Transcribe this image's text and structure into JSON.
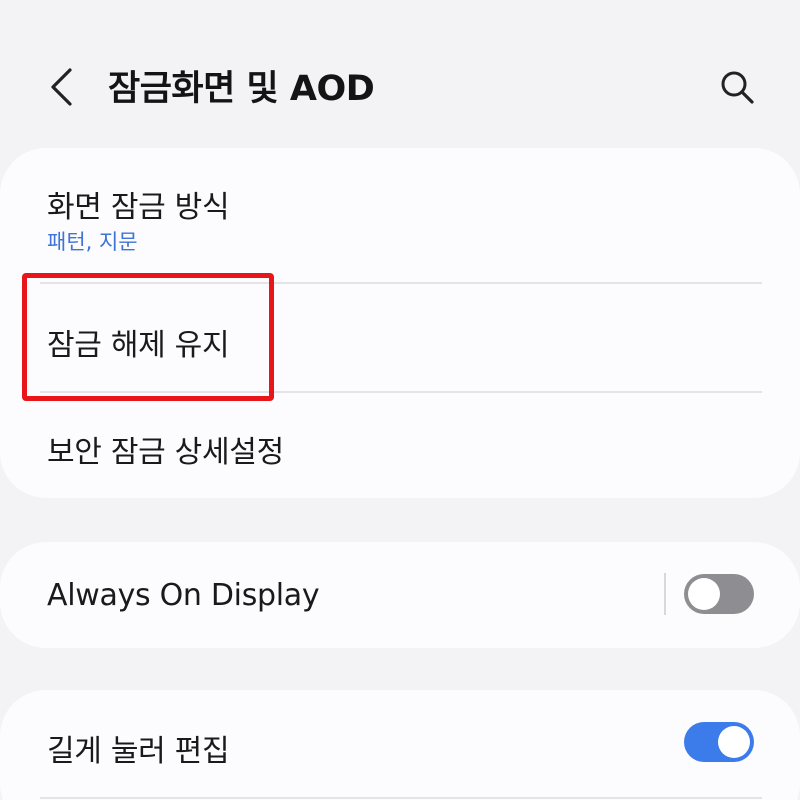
{
  "header": {
    "title": "잠금화면 및 AOD",
    "back_icon": "chevron-left-icon",
    "search_icon": "search-icon"
  },
  "lock_settings": {
    "items": [
      {
        "title": "화면 잠금 방식",
        "subtitle": "패턴, 지문"
      },
      {
        "title": "잠금 해제 유지"
      },
      {
        "title": "보안 잠금 상세설정"
      }
    ]
  },
  "aod": {
    "title": "Always On Display",
    "enabled": false
  },
  "long_press_edit": {
    "title": "길게 눌러 편집",
    "enabled": true
  },
  "colors": {
    "accent": "#3c7bea",
    "subtitle": "#3f73d6",
    "highlight": "#e8151b",
    "toggle_off": "#8e8e92"
  }
}
